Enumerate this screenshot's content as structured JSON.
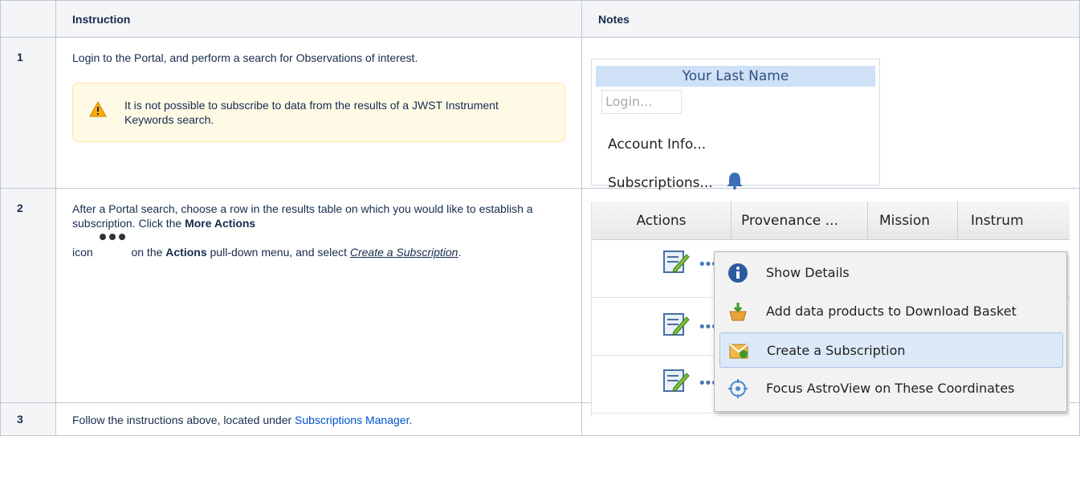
{
  "table": {
    "headers": {
      "number": "",
      "instruction": "Instruction",
      "notes": "Notes"
    },
    "rows": [
      {
        "number": "1",
        "instruction": "Login to the Portal, and perform a search for Observations of interest.",
        "warning": "It is not possible to subscribe to data from the results of a JWST Instrument Keywords search.",
        "notes_image": {
          "name_bar": "Your Last Name",
          "login_button": "Login...",
          "account_info": "Account Info...",
          "subscriptions": "Subscriptions..."
        }
      },
      {
        "number": "2",
        "instruction_part1": "After a Portal search, choose a row in the results table on which you would like to establish a subscription. Click the ",
        "bold_more_actions": "More Actions",
        "instruction_part2": " icon ",
        "instruction_part3": " on the ",
        "bold_actions": "Actions",
        "instruction_part4": " pull-down menu, and select ",
        "italic_link": "Create a Subscription",
        "instruction_part5": ".",
        "notes_image": {
          "columns": [
            "Actions",
            "Provenance ...",
            "Mission",
            "Instrum"
          ],
          "menu_items": [
            "Show Details",
            "Add data products to Download Basket",
            "Create a Subscription",
            "Focus AstroView on These Coordinates"
          ],
          "selected_item": "Create a Subscription",
          "row_dots": "•••"
        }
      },
      {
        "number": "3",
        "instruction_part1": "Follow the instructions above, located under ",
        "link": "Subscriptions Manager",
        "instruction_part2": "."
      }
    ]
  },
  "colors": {
    "header_bg": "#f4f5f7",
    "warning_bg": "#fffae6",
    "link": "#0052cc",
    "selected_menu": "#dce9f8"
  }
}
